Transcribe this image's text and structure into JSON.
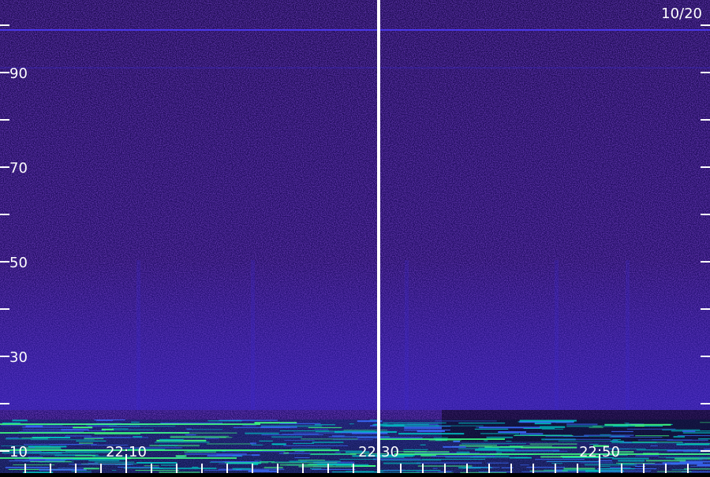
{
  "chart_data": {
    "type": "heatmap",
    "title": "",
    "date_label": "10/20",
    "xlabel": "",
    "ylabel": "",
    "y_tick_labels": [
      "10",
      "30",
      "50",
      "70",
      "90"
    ],
    "y_ticks_all": [
      10,
      20,
      30,
      40,
      50,
      60,
      70,
      80,
      90,
      100
    ],
    "ylim": [
      10,
      100
    ],
    "x_tick_labels": [
      "22:10",
      "22:30",
      "22:50"
    ],
    "x_range": [
      "22:00",
      "23:00"
    ],
    "panel_split_time": "22:30",
    "minor_tick_interval_minutes": 2,
    "colors": {
      "background": "#1a0a4a",
      "noise_low": "#2a0f7a",
      "noise_high": "#3b2bd6",
      "strong_signal": "#40ff80",
      "mid_signal": "#00c0c0",
      "separator": "#ffffff",
      "label": "#ffffff"
    },
    "features": {
      "persistent_line_y": 99,
      "faint_line_y": 91,
      "low_band_y": [
        10,
        15
      ]
    }
  }
}
